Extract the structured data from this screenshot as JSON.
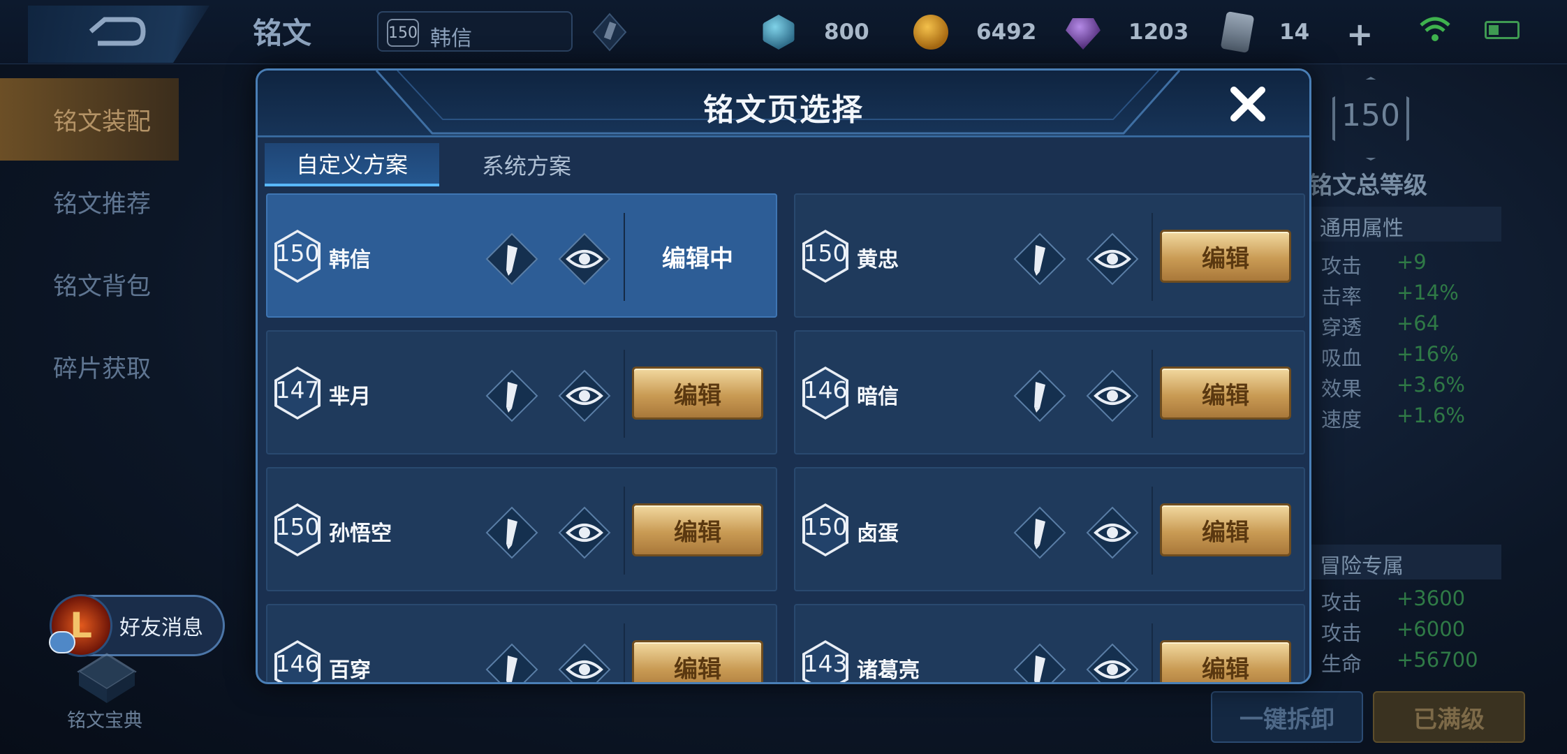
{
  "topbar": {
    "page_title": "铭文",
    "hero_level": "150",
    "hero_name": "韩信",
    "currencies": [
      {
        "icon": "diamond-icon",
        "value": "800"
      },
      {
        "icon": "gold-coin-icon",
        "value": "6492"
      },
      {
        "icon": "crystal-icon",
        "value": "1203"
      },
      {
        "icon": "card-icon",
        "value": "14"
      }
    ]
  },
  "sidebar": {
    "items": [
      {
        "label": "铭文装配",
        "active": true
      },
      {
        "label": "铭文推荐"
      },
      {
        "label": "铭文背包"
      },
      {
        "label": "碎片获取"
      }
    ]
  },
  "right_panel": {
    "total_level": "150",
    "total_level_label": "铭文总等级",
    "general_title": "通用属性",
    "general": [
      {
        "k": "攻击",
        "v": "+9"
      },
      {
        "k": "击率",
        "v": "+14%"
      },
      {
        "k": "穿透",
        "v": "+64"
      },
      {
        "k": "吸血",
        "v": "+16%"
      },
      {
        "k": "效果",
        "v": "+3.6%"
      },
      {
        "k": "速度",
        "v": "+1.6%"
      }
    ],
    "adventure_title": "冒险专属",
    "adventure": [
      {
        "k": "攻击",
        "v": "+3600"
      },
      {
        "k": "攻击",
        "v": "+6000"
      },
      {
        "k": "生命",
        "v": "+56700"
      }
    ],
    "unequip_all": "一键拆卸",
    "maxed": "已满级"
  },
  "friend_message": {
    "label": "好友消息"
  },
  "codex": {
    "label": "铭文宝典"
  },
  "modal": {
    "title": "铭文页选择",
    "tabs": [
      {
        "label": "自定义方案",
        "active": true
      },
      {
        "label": "系统方案"
      }
    ],
    "cards": [
      {
        "level": "150",
        "name": "韩信",
        "action": "编辑中",
        "selected": true
      },
      {
        "level": "150",
        "name": "黄忠",
        "action": "编辑"
      },
      {
        "level": "147",
        "name": "芈月",
        "action": "编辑"
      },
      {
        "level": "146",
        "name": "暗信",
        "action": "编辑"
      },
      {
        "level": "150",
        "name": "孙悟空",
        "action": "编辑"
      },
      {
        "level": "150",
        "name": "卤蛋",
        "action": "编辑"
      },
      {
        "level": "146",
        "name": "百穿",
        "action": "编辑"
      },
      {
        "level": "143",
        "name": "诸葛亮",
        "action": "编辑"
      }
    ]
  },
  "colors": {
    "accent_blue": "#59b8ff",
    "gold_button": "#c99b54",
    "positive_green": "#2f7a46"
  }
}
